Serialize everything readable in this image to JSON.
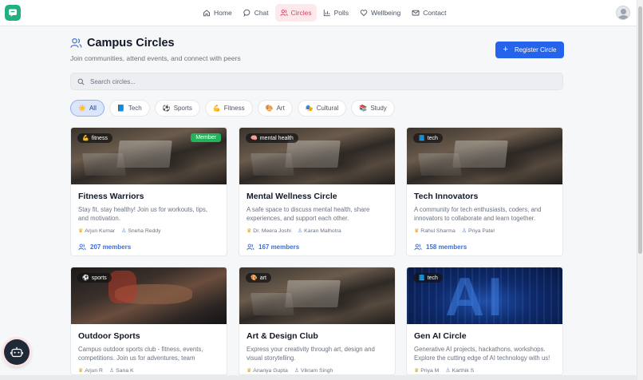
{
  "nav": {
    "items": [
      {
        "label": "Home",
        "icon": "home-icon"
      },
      {
        "label": "Chat",
        "icon": "chat-icon"
      },
      {
        "label": "Circles",
        "icon": "users-icon"
      },
      {
        "label": "Polls",
        "icon": "bar-chart-icon"
      },
      {
        "label": "Wellbeing",
        "icon": "heart-icon"
      },
      {
        "label": "Contact",
        "icon": "mail-icon"
      }
    ],
    "active": "Circles"
  },
  "header": {
    "title": "Campus Circles",
    "subtitle": "Join communities, attend events, and connect with peers",
    "register_label": "Register Circle"
  },
  "search": {
    "placeholder": "Search circles..."
  },
  "filters": [
    {
      "label": "All",
      "icon": "☀️"
    },
    {
      "label": "Tech",
      "icon": "📘"
    },
    {
      "label": "Sports",
      "icon": "⚽"
    },
    {
      "label": "Fitness",
      "icon": "💪"
    },
    {
      "label": "Art",
      "icon": "🎨"
    },
    {
      "label": "Cultural",
      "icon": "🎭"
    },
    {
      "label": "Study",
      "icon": "📚"
    }
  ],
  "cards": [
    {
      "tag": "fitness",
      "tag_icon": "💪",
      "member_badge": "Member",
      "title": "Fitness Warriors",
      "desc": "Stay fit, stay healthy! Join us for workouts, tips, and motivation.",
      "leader": "Arjun Kumar",
      "coordinator": "Sneha Reddy",
      "members": "207 members"
    },
    {
      "tag": "mental health",
      "tag_icon": "🧠",
      "title": "Mental Wellness Circle",
      "desc": "A safe space to discuss mental health, share experiences, and support each other.",
      "leader": "Dr. Meera Joshi",
      "coordinator": "Karan Malhotra",
      "members": "167 members"
    },
    {
      "tag": "tech",
      "tag_icon": "📘",
      "title": "Tech Innovators",
      "desc": "A community for tech enthusiasts, coders, and innovators to collaborate and learn together.",
      "leader": "Rahul Sharma",
      "coordinator": "Priya Patel",
      "members": "158 members"
    },
    {
      "tag": "sports",
      "tag_icon": "⚽",
      "title": "Outdoor Sports",
      "desc": "Campus outdoor sports club - fitness, events, competitions. Join us for adventures, team sports,...",
      "leader": "Arjun R",
      "coordinator": "Sana K"
    },
    {
      "tag": "art",
      "tag_icon": "🎨",
      "title": "Art & Design Club",
      "desc": "Express your creativity through art, design and visual storytelling.",
      "leader": "Ananya Gupta",
      "coordinator": "Vikram Singh"
    },
    {
      "tag": "tech",
      "tag_icon": "📘",
      "title": "Gen AI Circle",
      "desc": "Generative AI projects, hackathons, workshops. Explore the cutting edge of AI technology with us!",
      "leader": "Priya M",
      "coordinator": "Karthik S",
      "image_text": "AI"
    }
  ]
}
